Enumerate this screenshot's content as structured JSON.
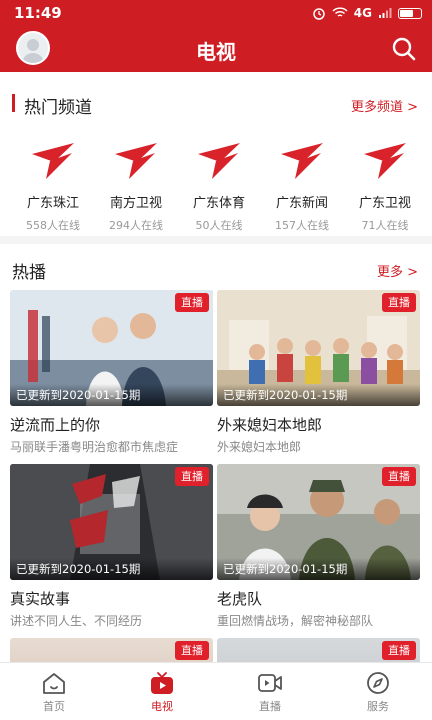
{
  "status_bar": {
    "time": "11:49",
    "network": "4G"
  },
  "header": {
    "title": "电视"
  },
  "channels_section": {
    "title": "热门频道",
    "more_label": "更多频道 >",
    "channels": [
      {
        "name": "广东珠江",
        "viewers": "558人在线"
      },
      {
        "name": "南方卫视",
        "viewers": "294人在线"
      },
      {
        "name": "广东体育",
        "viewers": "50人在线"
      },
      {
        "name": "广东新闻",
        "viewers": "157人在线"
      },
      {
        "name": "广东卫视",
        "viewers": "71人在线"
      }
    ]
  },
  "hot_section": {
    "title": "热播",
    "more_label": "更多 >",
    "items": [
      {
        "badge": "直播",
        "update": "已更新到2020-01-15期",
        "title": "逆流而上的你",
        "subtitle": "马丽联手潘粤明治愈都市焦虑症"
      },
      {
        "badge": "直播",
        "update": "已更新到2020-01-15期",
        "title": "外来媳妇本地郎",
        "subtitle": "外来媳妇本地郎"
      },
      {
        "badge": "直播",
        "update": "已更新到2020-01-15期",
        "title": "真实故事",
        "subtitle": "讲述不同人生、不同经历"
      },
      {
        "badge": "直播",
        "update": "已更新到2020-01-15期",
        "title": "老虎队",
        "subtitle": "重回燃情战场，解密神秘部队"
      },
      {
        "badge": "直播"
      },
      {
        "badge": "直播"
      }
    ]
  },
  "tabbar": {
    "tabs": [
      {
        "label": "首页",
        "icon": "home-icon",
        "active": false
      },
      {
        "label": "电视",
        "icon": "tv-icon",
        "active": true
      },
      {
        "label": "直播",
        "icon": "live-video-icon",
        "active": false
      },
      {
        "label": "服务",
        "icon": "compass-icon",
        "active": false
      }
    ]
  },
  "colors": {
    "brand_red": "#cf1d24",
    "badge_red": "#e0202b",
    "text_primary": "#222222",
    "text_secondary": "#888888"
  }
}
